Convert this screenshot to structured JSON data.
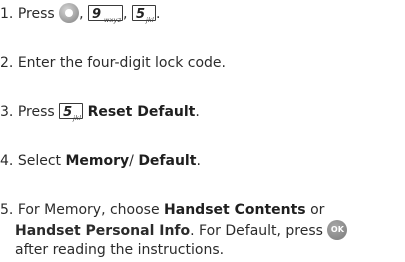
{
  "steps": [
    {
      "number": "1.",
      "press": "Press",
      "sep1": ",",
      "sep2": ",",
      "end": ".",
      "key9_digit": "9",
      "key9_letters": "wxyz",
      "key5_digit": "5",
      "key5_letters": "jkl"
    },
    {
      "number": "2.",
      "text": "Enter the four-digit lock code."
    },
    {
      "number": "3.",
      "press": "Press",
      "key5_digit": "5",
      "key5_letters": "jkl",
      "bold": "Reset Default",
      "end": "."
    },
    {
      "number": "4.",
      "select": "Select",
      "bold1": "Memory",
      "slash": "/",
      "bold2": "Default",
      "end": "."
    },
    {
      "number": "5.",
      "line1_pre": "For Memory, choose",
      "line1_bold": "Handset Contents",
      "line1_post": "or",
      "line2_bold": "Handset Personal Info",
      "line2_post": ". For Default, press",
      "ok_label": "OK",
      "line3": "after reading the instructions."
    }
  ],
  "icons": {
    "nav_key": "menu-ok-key-icon",
    "ok_key": "ok-key-icon"
  }
}
